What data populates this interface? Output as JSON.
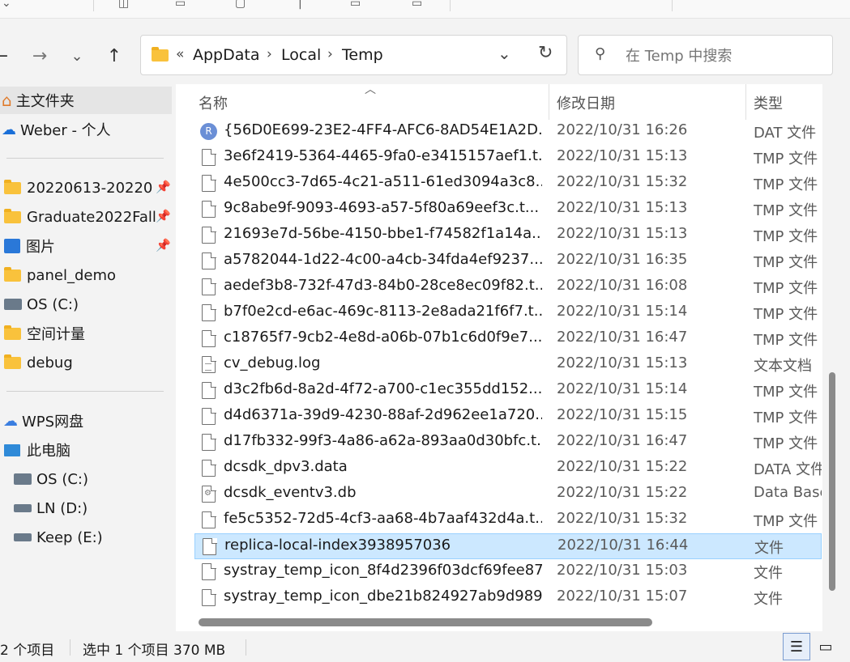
{
  "address": {
    "overflow": "«",
    "crumbs": [
      "AppData",
      "Local",
      "Temp"
    ],
    "sep": "›"
  },
  "search": {
    "placeholder": "在 Temp 中搜索"
  },
  "sidebar": {
    "items": [
      {
        "label": "主文件夹",
        "icon": "home-icon"
      },
      {
        "label": "Weber - 个人",
        "icon": "cloud-icon"
      },
      {
        "label": "20220613-20220",
        "icon": "folder-icon"
      },
      {
        "label": "Graduate2022Fall",
        "icon": "folder-icon"
      },
      {
        "label": "图片",
        "icon": "pictures-icon"
      },
      {
        "label": "panel_demo",
        "icon": "folder-icon"
      },
      {
        "label": "OS (C:)",
        "icon": "drive-icon"
      },
      {
        "label": "空间计量",
        "icon": "folder-icon"
      },
      {
        "label": "debug",
        "icon": "folder-icon"
      },
      {
        "label": "WPS网盘",
        "icon": "cloud-icon"
      },
      {
        "label": "此电脑",
        "icon": "pc-icon"
      },
      {
        "label": "OS (C:)",
        "icon": "drive-icon"
      },
      {
        "label": "LN (D:)",
        "icon": "drive-icon"
      },
      {
        "label": "Keep (E:)",
        "icon": "drive-icon"
      }
    ]
  },
  "columns": {
    "name": "名称",
    "date": "修改日期",
    "type": "类型"
  },
  "files": [
    {
      "name": "{56D0E699-23E2-4FF4-AFC6-8AD54E1A2D...",
      "date": "2022/10/31 16:26",
      "type": "DAT 文件",
      "icon": "r"
    },
    {
      "name": "3e6f2419-5364-4465-9fa0-e3415157aef1.t...",
      "date": "2022/10/31 15:13",
      "type": "TMP 文件",
      "icon": "blank"
    },
    {
      "name": "4e500cc3-7d65-4c21-a511-61ed3094a3c8....",
      "date": "2022/10/31 15:32",
      "type": "TMP 文件",
      "icon": "blank"
    },
    {
      "name": "9c8abe9f-9093-4693-a57-5f80a69eef3c.t...",
      "date": "2022/10/31 15:13",
      "type": "TMP 文件",
      "icon": "blank"
    },
    {
      "name": "21693e7d-56be-4150-bbe1-f74582f1a14a...",
      "date": "2022/10/31 15:13",
      "type": "TMP 文件",
      "icon": "blank"
    },
    {
      "name": "a5782044-1d22-4c00-a4cb-34fda4ef9237....",
      "date": "2022/10/31 16:35",
      "type": "TMP 文件",
      "icon": "blank"
    },
    {
      "name": "aedef3b8-732f-47d3-84b0-28ce8ec09f82.t...",
      "date": "2022/10/31 16:08",
      "type": "TMP 文件",
      "icon": "blank"
    },
    {
      "name": "b7f0e2cd-e6ac-469c-8113-2e8ada21f6f7.t...",
      "date": "2022/10/31 15:14",
      "type": "TMP 文件",
      "icon": "blank"
    },
    {
      "name": "c18765f7-9cb2-4e8d-a06b-07b1c6d0f9e7....",
      "date": "2022/10/31 16:47",
      "type": "TMP 文件",
      "icon": "blank"
    },
    {
      "name": "cv_debug.log",
      "date": "2022/10/31 15:13",
      "type": "文本文档",
      "icon": "doc"
    },
    {
      "name": "d3c2fb6d-8a2d-4f72-a700-c1ec355dd152....",
      "date": "2022/10/31 15:14",
      "type": "TMP 文件",
      "icon": "blank"
    },
    {
      "name": "d4d6371a-39d9-4230-88af-2d962ee1a720...",
      "date": "2022/10/31 15:15",
      "type": "TMP 文件",
      "icon": "blank"
    },
    {
      "name": "d17fb332-99f3-4a86-a62a-893aa0d30bfc.t...",
      "date": "2022/10/31 16:47",
      "type": "TMP 文件",
      "icon": "blank"
    },
    {
      "name": "dcsdk_dpv3.data",
      "date": "2022/10/31 15:22",
      "type": "DATA 文件",
      "icon": "blank"
    },
    {
      "name": "dcsdk_eventv3.db",
      "date": "2022/10/31 15:22",
      "type": "Data Base",
      "icon": "db"
    },
    {
      "name": "fe5c5352-72d5-4cf3-aa68-4b7aaf432d4a.t...",
      "date": "2022/10/31 15:32",
      "type": "TMP 文件",
      "icon": "blank"
    },
    {
      "name": "replica-local-index3938957036",
      "date": "2022/10/31 16:44",
      "type": "文件",
      "icon": "blank",
      "selected": true
    },
    {
      "name": "systray_temp_icon_8f4d2396f03dcf69fee87...",
      "date": "2022/10/31 15:03",
      "type": "文件",
      "icon": "blank"
    },
    {
      "name": "systray_temp_icon_dbe21b824927ab9d989...",
      "date": "2022/10/31 15:07",
      "type": "文件",
      "icon": "blank"
    }
  ],
  "status": {
    "count": "2 个项目",
    "selection": "选中 1 个项目  370 MB"
  },
  "icons": {
    "r_letter": "R"
  }
}
